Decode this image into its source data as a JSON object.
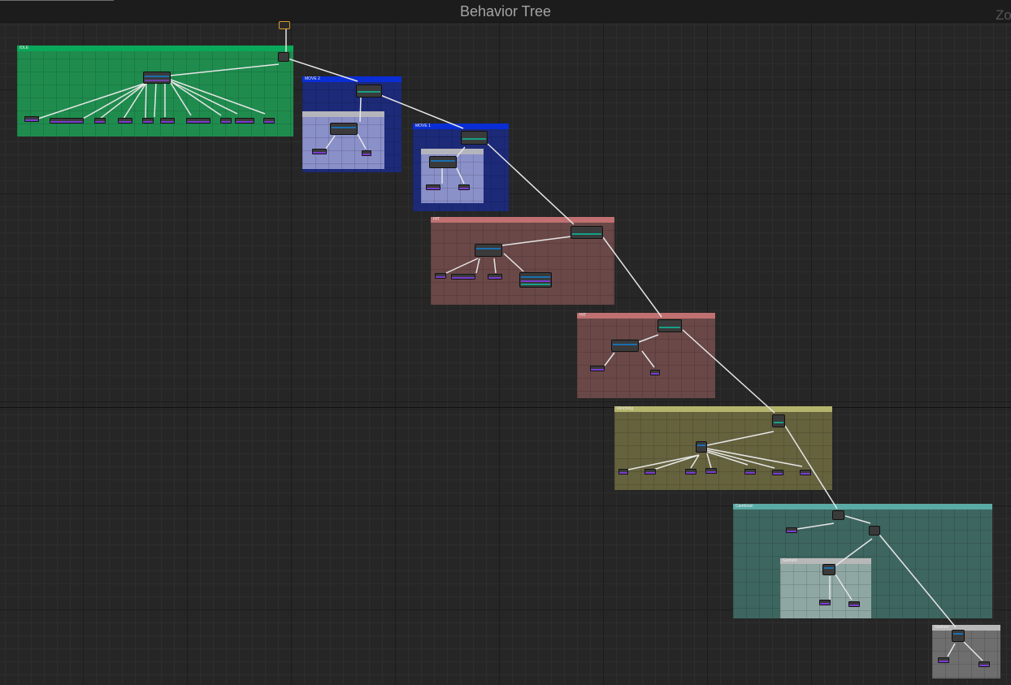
{
  "editor": {
    "title": "Behavior Tree",
    "zoom_label": "Zo"
  },
  "comments": [
    {
      "label": "IDLE",
      "color": "#1f8c4e",
      "header": "#0aa85a"
    },
    {
      "label": "MOVE 2",
      "color": "#1c2a78",
      "header": "#0a2ed6"
    },
    {
      "label": "",
      "color": "#8a90c8",
      "header": "#b4b4bc"
    },
    {
      "label": "MOVE 1",
      "color": "#1c2a78",
      "header": "#0a2ed6"
    },
    {
      "label": "",
      "color": "#8a90c8",
      "header": "#b4b4bc"
    },
    {
      "label": "HIT",
      "color": "#6a4848",
      "header": "#c07070"
    },
    {
      "label": "HIT",
      "color": "#6a4848",
      "header": "#c07070"
    },
    {
      "label": "Flinching",
      "color": "#65623e",
      "header": "#b4b46c"
    },
    {
      "label": "Cambrian",
      "color": "#3e6660",
      "header": "#5aaaa6"
    },
    {
      "label": "Gesture",
      "color": "#8fa7a3",
      "header": "#b8b8b8"
    },
    {
      "label": "Gesture",
      "color": "#6e6e6e",
      "header": "#b8b8b8"
    }
  ],
  "colors": {
    "canvas": "#262626",
    "link": "#e6e6e6",
    "task_accent": "#7a3ccf",
    "composite_accent": "#1a6fb0",
    "decorator_accent": "#16a085",
    "root_border": "#d89a2a"
  }
}
